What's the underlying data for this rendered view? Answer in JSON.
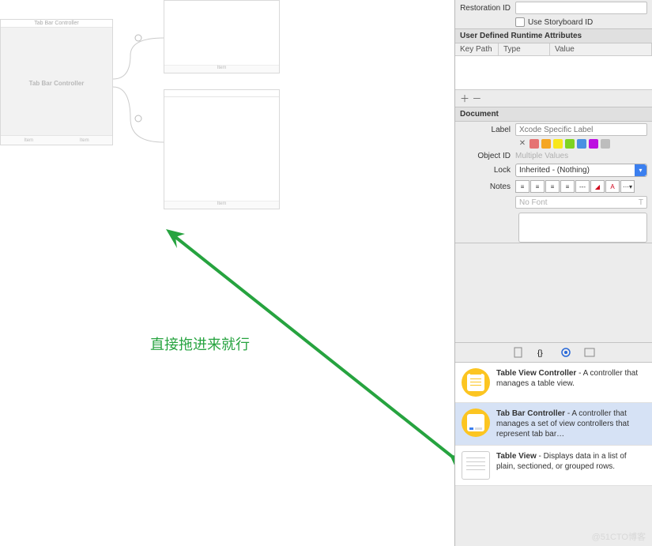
{
  "canvas": {
    "tab_bar_controller_title": "Tab Bar Controller",
    "tab_bar_controller_label": "Tab Bar Controller",
    "item_label": "Item"
  },
  "annotation": "直接拖进来就行",
  "inspector": {
    "restoration_id_label": "Restoration ID",
    "use_storyboard_id_label": "Use Storyboard ID",
    "uda_header": "User Defined Runtime Attributes",
    "uda_cols": {
      "keypath": "Key Path",
      "type": "Type",
      "value": "Value"
    },
    "add": "＋",
    "remove": "－",
    "document_header": "Document",
    "label_label": "Label",
    "label_placeholder": "Xcode Specific Label",
    "object_id_label": "Object ID",
    "object_id_value": "Multiple Values",
    "lock_label": "Lock",
    "lock_value": "Inherited - (Nothing)",
    "notes_label": "Notes",
    "no_font": "No Font",
    "colors": [
      "#e57373",
      "#f5a623",
      "#f8e71c",
      "#7ed321",
      "#4a90e2",
      "#9013fe",
      "#bdbdbd"
    ]
  },
  "library": {
    "items": [
      {
        "title": "Table View Controller",
        "desc": " - A controller that manages a table view.",
        "icon": "yellow-lines",
        "selected": false
      },
      {
        "title": "Tab Bar Controller",
        "desc": " - A controller that manages a set of view controllers that represent tab bar…",
        "icon": "yellow-tab",
        "selected": true
      },
      {
        "title": "Table View",
        "desc": " - Displays data in a list of plain, sectioned, or grouped rows.",
        "icon": "gray",
        "selected": false
      }
    ]
  },
  "watermark": "@51CTO博客"
}
